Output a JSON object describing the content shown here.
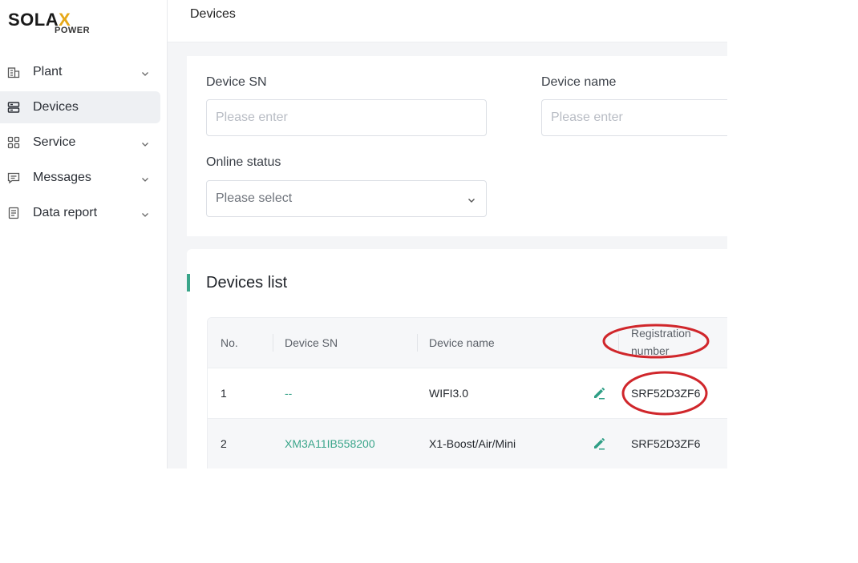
{
  "brand": {
    "logo_main": "SOLA",
    "logo_x": "X",
    "logo_sub": "POWER"
  },
  "sidebar": {
    "items": [
      {
        "label": "Plant",
        "icon": "building-icon",
        "expandable": true,
        "active": false
      },
      {
        "label": "Devices",
        "icon": "server-icon",
        "expandable": false,
        "active": true
      },
      {
        "label": "Service",
        "icon": "grid-icon",
        "expandable": true,
        "active": false
      },
      {
        "label": "Messages",
        "icon": "message-icon",
        "expandable": true,
        "active": false
      },
      {
        "label": "Data report",
        "icon": "report-icon",
        "expandable": true,
        "active": false
      }
    ]
  },
  "header": {
    "title": "Devices"
  },
  "filters": {
    "device_sn": {
      "label": "Device SN",
      "placeholder": "Please enter"
    },
    "device_name": {
      "label": "Device name",
      "placeholder": "Please enter"
    },
    "online_status": {
      "label": "Online status",
      "placeholder": "Please select"
    }
  },
  "devices_list": {
    "title": "Devices list",
    "columns": [
      "No.",
      "Device SN",
      "Device name",
      "Registration",
      "number"
    ],
    "rows": [
      {
        "no": "1",
        "sn": "--",
        "name": "WIFI3.0",
        "registration": "SRF52D3ZF6"
      },
      {
        "no": "2",
        "sn": "XM3A11IB558200",
        "name": "X1-Boost/Air/Mini",
        "registration": "SRF52D3ZF6"
      }
    ]
  },
  "colors": {
    "accent": "#3aa58a",
    "annotation": "#d0262b",
    "logo_x": "#e6a817"
  }
}
